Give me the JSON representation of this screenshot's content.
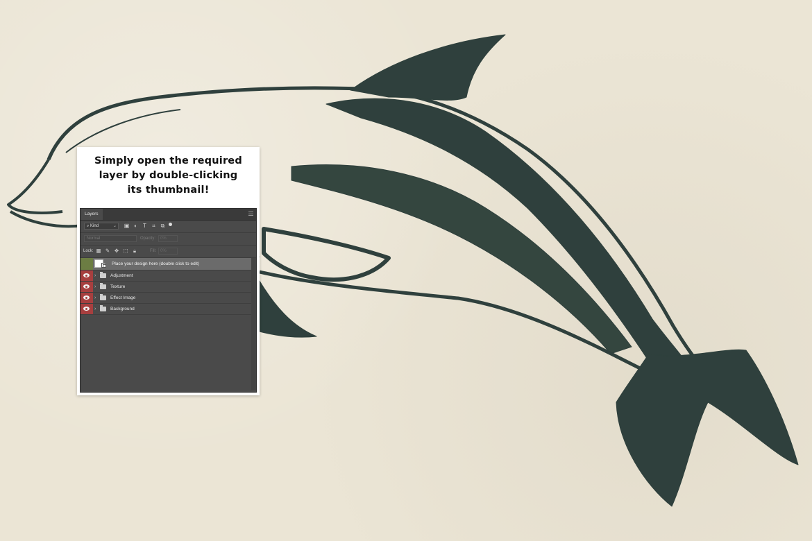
{
  "callout": {
    "lines": [
      "Simply open the required",
      "layer by double-clicking",
      "its thumbnail!"
    ]
  },
  "layers_panel": {
    "tab_label": "Layers",
    "filter_kind": "Kind",
    "filter_icons": [
      "image-filter-icon",
      "adjustment-filter-icon",
      "type-filter-icon",
      "shape-filter-icon",
      "smart-object-filter-icon",
      "filter-toggle-dot"
    ],
    "blend_mode": "Normal",
    "opacity_label": "Opacity:",
    "opacity_value": "0%",
    "lock_label": "Lock:",
    "lock_icons": [
      "lock-transparent-icon",
      "lock-image-icon",
      "lock-position-icon",
      "lock-artboard-icon",
      "lock-all-icon"
    ],
    "fill_label": "Fill:",
    "fill_value": "0%",
    "layers": [
      {
        "name": "Place your design here (double click to edit)",
        "type": "smart-object",
        "selected": true,
        "visibility_color": "#6c7d43"
      },
      {
        "name": "Adjustment",
        "type": "group",
        "visibility_color": "#a73f3f"
      },
      {
        "name": "Texture",
        "type": "group",
        "visibility_color": "#a73f3f"
      },
      {
        "name": "Effect Image",
        "type": "group",
        "visibility_color": "#a73f3f"
      },
      {
        "name": "Background",
        "type": "group",
        "visibility_color": "#a73f3f"
      }
    ]
  },
  "colors": {
    "paper": "#ebe5d5",
    "ink": "#2f403d",
    "panel_bg": "#4a4a4a",
    "eye_red": "#a73f3f",
    "eye_green": "#6c7d43"
  }
}
